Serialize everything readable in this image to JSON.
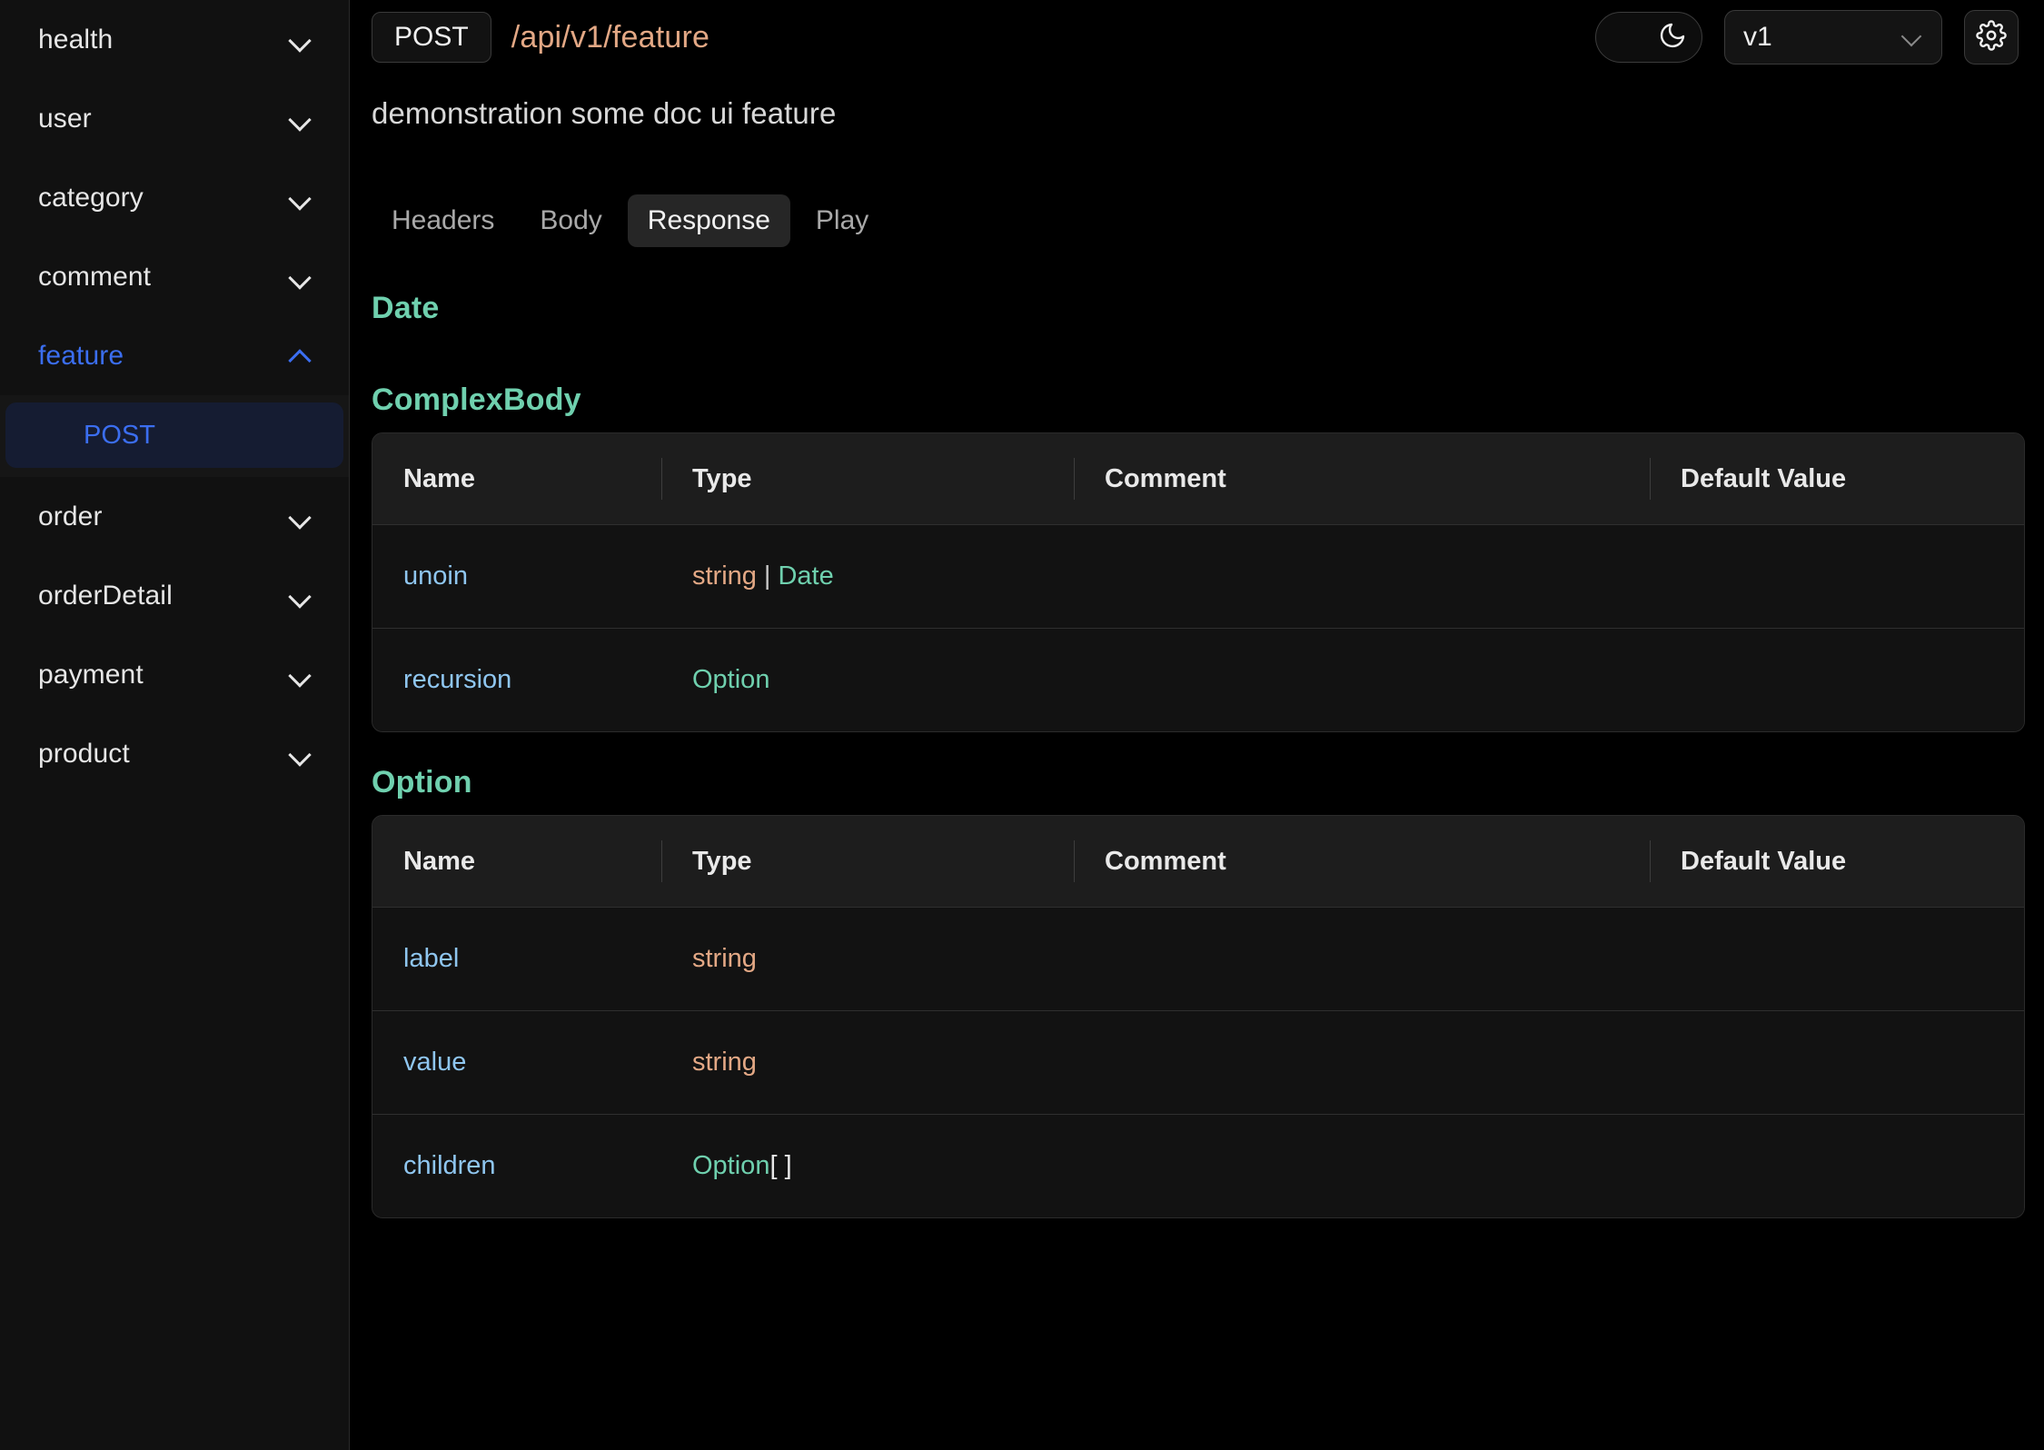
{
  "sidebar": {
    "items": [
      {
        "label": "health",
        "icon": "chevron-down-icon",
        "expanded": false
      },
      {
        "label": "user",
        "icon": "chevron-down-icon",
        "expanded": false
      },
      {
        "label": "category",
        "icon": "chevron-down-icon",
        "expanded": false
      },
      {
        "label": "comment",
        "icon": "chevron-down-icon",
        "expanded": false
      },
      {
        "label": "feature",
        "icon": "chevron-up-icon",
        "expanded": true
      },
      {
        "label": "order",
        "icon": "chevron-down-icon",
        "expanded": false
      },
      {
        "label": "orderDetail",
        "icon": "chevron-down-icon",
        "expanded": false
      },
      {
        "label": "payment",
        "icon": "chevron-down-icon",
        "expanded": false
      },
      {
        "label": "product",
        "icon": "chevron-down-icon",
        "expanded": false
      }
    ],
    "feature_children": [
      {
        "label": "POST",
        "active": true
      }
    ]
  },
  "topbar": {
    "method": "POST",
    "path": "/api/v1/feature",
    "theme_toggle_icon": "moon-icon",
    "version_value": "v1",
    "version_chevron_icon": "chevron-down-icon",
    "settings_icon": "gear-icon"
  },
  "summary": "demonstration some doc ui feature",
  "tabs": [
    {
      "label": "Headers",
      "active": false
    },
    {
      "label": "Body",
      "active": false
    },
    {
      "label": "Response",
      "active": true
    },
    {
      "label": "Play",
      "active": false
    }
  ],
  "columns": [
    "Name",
    "Type",
    "Comment",
    "Default Value"
  ],
  "sections": [
    {
      "title": "Date",
      "has_table": false,
      "rows": []
    },
    {
      "title": "ComplexBody",
      "has_table": true,
      "rows": [
        {
          "name": "unoin",
          "type_parts": [
            {
              "text": "string",
              "kind": "primitive"
            },
            {
              "text": "|",
              "kind": "separator"
            },
            {
              "text": "Date",
              "kind": "reference"
            }
          ],
          "comment": "",
          "default": ""
        },
        {
          "name": "recursion",
          "type_parts": [
            {
              "text": "Option",
              "kind": "reference"
            }
          ],
          "comment": "",
          "default": ""
        }
      ]
    },
    {
      "title": "Option",
      "has_table": true,
      "rows": [
        {
          "name": "label",
          "type_parts": [
            {
              "text": "string",
              "kind": "primitive"
            }
          ],
          "comment": "",
          "default": ""
        },
        {
          "name": "value",
          "type_parts": [
            {
              "text": "string",
              "kind": "primitive"
            }
          ],
          "comment": "",
          "default": ""
        },
        {
          "name": "children",
          "type_parts": [
            {
              "text": "Option",
              "kind": "reference"
            },
            {
              "text": "[ ]",
              "kind": "brackets"
            }
          ],
          "comment": "",
          "default": ""
        }
      ]
    }
  ],
  "colors": {
    "accent_blue": "#3b6ef0",
    "type_primitive": "#e3a885",
    "type_reference": "#6fd0ae",
    "field_name": "#8fc6f0",
    "background": "#000000",
    "sidebar_background": "#111111"
  }
}
